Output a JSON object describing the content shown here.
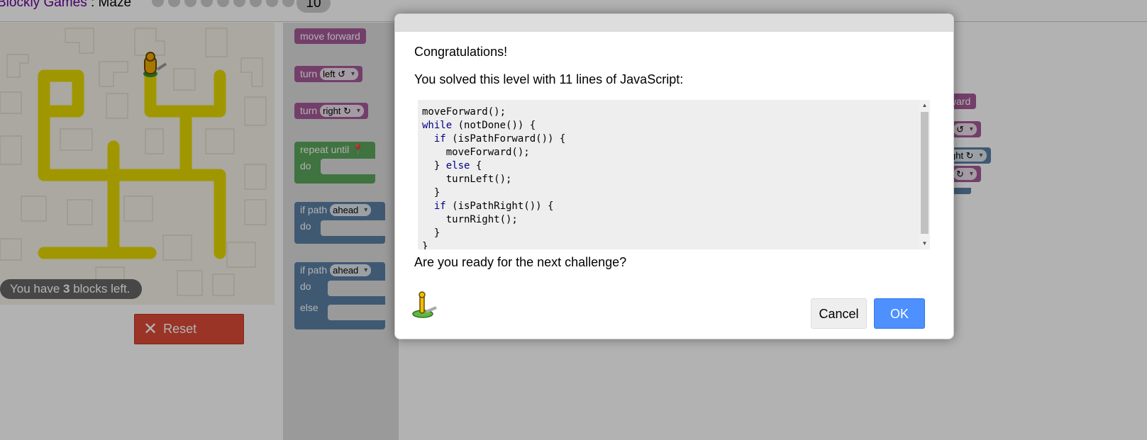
{
  "header": {
    "app_link": "Blockly Games",
    "separator": " : ",
    "game": "Maze",
    "level": "10",
    "level_dots": 9
  },
  "maze": {
    "blocks_left_prefix": "You have ",
    "blocks_left_count": "3",
    "blocks_left_suffix": " blocks left.",
    "reset_label": "Reset",
    "colors": {
      "path": "#e5d900",
      "background": "#f4f1e6",
      "reset": "#dd4b39"
    }
  },
  "toolbox": {
    "move_forward": "move forward",
    "turn": "turn",
    "left_option": "left ↺",
    "right_option": "right ↻",
    "repeat_until": "repeat until",
    "do": "do",
    "else": "else",
    "if_path": "if path",
    "ahead_option": "ahead"
  },
  "workspace": {
    "forward_fragment": "ward",
    "left_fragment": "↺",
    "right_fragment": "ght ↻",
    "right_fragment2": "↻"
  },
  "dialog": {
    "congrats": "Congratulations!",
    "solved": "You solved this level with 11 lines of JavaScript:",
    "code_lines": [
      "moveForward();",
      "while (notDone()) {",
      "  if (isPathForward()) {",
      "    moveForward();",
      "  } else {",
      "    turnLeft();",
      "  }",
      "  if (isPathRight()) {",
      "    turnRight();",
      "  }",
      "}"
    ],
    "next": "Are you ready for the next challenge?",
    "cancel_label": "Cancel",
    "ok_label": "OK",
    "colors": {
      "ok": "#4d90fe",
      "keyword": "#000088"
    }
  }
}
